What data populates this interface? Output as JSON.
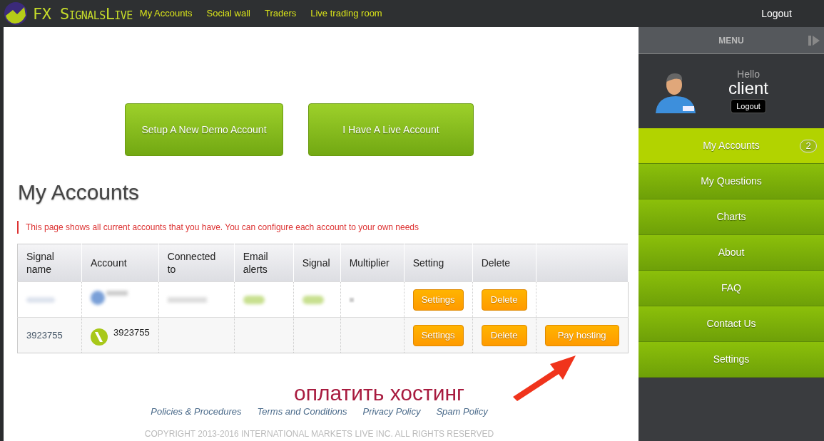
{
  "top_bar": {
    "logo": "FX SignalsLive",
    "nav": [
      "My Accounts",
      "Social wall",
      "Traders",
      "Live trading room"
    ],
    "logout": "Logout"
  },
  "actions": [
    "Setup A New Demo Account",
    "I Have A Live Account"
  ],
  "page_title": "My Accounts",
  "notice": "This page shows all current accounts that you have. You can configure each account to your own needs",
  "table": {
    "columns": [
      "Signal name",
      "Account",
      "Connected to",
      "Email alerts",
      "Signal",
      "Multiplier",
      "Setting",
      "Delete"
    ],
    "rows": [
      {
        "kind": "blurred",
        "email_alerts_on": true,
        "signal_on": true,
        "settings": "Settings",
        "delete": "Delete"
      },
      {
        "kind": "plain",
        "signal_name": "3923755",
        "account": "3923755",
        "settings": "Settings",
        "delete": "Delete",
        "pay": "Pay hosting"
      }
    ]
  },
  "annotation": "оплатить хостинг",
  "footer": {
    "links": [
      "Policies & Procedures",
      "Terms and Conditions",
      "Privacy Policy",
      "Spam Policy"
    ],
    "copyright": "COPYRIGHT 2013-2016 INTERNATIONAL MARKETS LIVE INC. ALL RIGHTS RESERVED"
  },
  "sidebar": {
    "title": "MENU",
    "greeting": "Hello",
    "user": "client",
    "logout": "Logout",
    "items": [
      {
        "label": "My Accounts",
        "selected": true,
        "badge": "2"
      },
      {
        "label": "My Questions",
        "selected": false
      },
      {
        "label": "Charts",
        "selected": false
      },
      {
        "label": "About",
        "selected": false
      },
      {
        "label": "FAQ",
        "selected": false
      },
      {
        "label": "Contact Us",
        "selected": false
      },
      {
        "label": "Settings",
        "selected": false
      }
    ]
  }
}
